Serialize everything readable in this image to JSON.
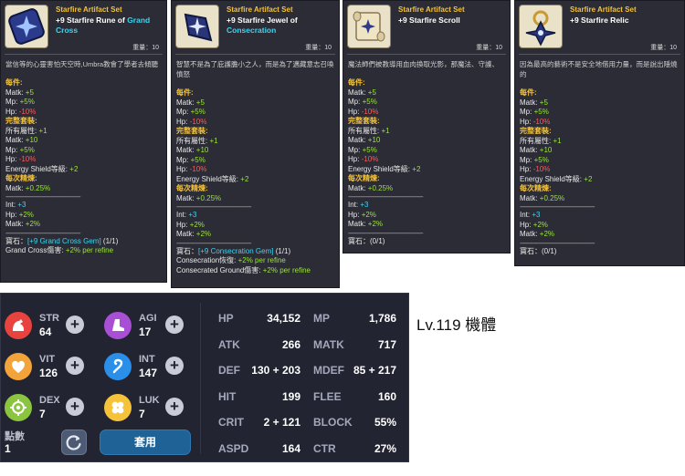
{
  "cards": [
    {
      "set": "Starfire Artifact Set",
      "name_prefix": "+9 Starfire Rune of ",
      "name_highlight": "Grand Cross",
      "weight": "重量：10",
      "description": "當信等的心靈害怕天空時,Umbra教會了學者去傾聽",
      "each_label": "每件:",
      "each": [
        [
          "Matk:",
          "+5",
          "g"
        ],
        [
          "Mp:",
          "+5%",
          "g"
        ],
        [
          "Hp:",
          "-10%",
          "r"
        ]
      ],
      "full_label": "完整套裝:",
      "full": [
        [
          "所有屬性:",
          "+1",
          "g"
        ],
        [
          "Matk:",
          "+10",
          "g"
        ],
        [
          "Mp:",
          "+5%",
          "g"
        ],
        [
          "Hp:",
          "-10%",
          "r"
        ],
        [
          "Energy Shield等級:",
          "+2",
          "g"
        ]
      ],
      "refine_label": "每次精煉:",
      "refine": [
        [
          "Matk:",
          "+0.25%",
          "g"
        ]
      ],
      "dashes": "-------------------------------------------------",
      "bonus": [
        [
          "Int:",
          "+3",
          "b"
        ],
        [
          "Hp:",
          "+2%",
          "g"
        ],
        [
          "Matk:",
          "+2%",
          "g"
        ]
      ],
      "gem_prefix": "寶石：",
      "gem_link": "[+9 Grand Cross Gem]",
      "gem_count": " (1/1)",
      "extras": [
        [
          "Grand Cross傷害:",
          "+2% per refine"
        ]
      ]
    },
    {
      "set": "Starfire Artifact Set",
      "name_prefix": "+9 Starfire Jewel of ",
      "name_highlight": "Consecration",
      "weight": "重量：10",
      "description": "智慧不是為了庇護膽小之人，而是為了邁藏意志召喚憤怒",
      "each_label": "每件:",
      "each": [
        [
          "Matk:",
          "+5",
          "g"
        ],
        [
          "Mp:",
          "+5%",
          "g"
        ],
        [
          "Hp:",
          "-10%",
          "r"
        ]
      ],
      "full_label": "完整套裝:",
      "full": [
        [
          "所有屬性:",
          "+1",
          "g"
        ],
        [
          "Matk:",
          "+10",
          "g"
        ],
        [
          "Mp:",
          "+5%",
          "g"
        ],
        [
          "Hp:",
          "-10%",
          "r"
        ],
        [
          "Energy Shield等級:",
          "+2",
          "g"
        ]
      ],
      "refine_label": "每次精煉:",
      "refine": [
        [
          "Matk:",
          "+0.25%",
          "g"
        ]
      ],
      "dashes": "-------------------------------------------------",
      "bonus": [
        [
          "Int:",
          "+3",
          "b"
        ],
        [
          "Hp:",
          "+2%",
          "g"
        ],
        [
          "Matk:",
          "+2%",
          "g"
        ]
      ],
      "gem_prefix": "寶石：",
      "gem_link": "[+9 Consecration Gem]",
      "gem_count": " (1/1)",
      "extras": [
        [
          "Consecration恢復:",
          "+2% per refine"
        ],
        [
          "Consecrated Ground傷害:",
          "+2% per refine"
        ]
      ]
    },
    {
      "set": "Starfire Artifact Set",
      "name_prefix": "+9 Starfire Scroll",
      "name_highlight": "",
      "weight": "重量：10",
      "description": "魔法師們被教導用血肉換取光影，那魔法、守護、",
      "each_label": "每件:",
      "each": [
        [
          "Matk:",
          "+5",
          "g"
        ],
        [
          "Mp:",
          "+5%",
          "g"
        ],
        [
          "Hp:",
          "-10%",
          "r"
        ]
      ],
      "full_label": "完整套裝:",
      "full": [
        [
          "所有屬性:",
          "+1",
          "g"
        ],
        [
          "Matk:",
          "+10",
          "g"
        ],
        [
          "Mp:",
          "+5%",
          "g"
        ],
        [
          "Hp:",
          "-10%",
          "r"
        ],
        [
          "Energy Shield等級:",
          "+2",
          "g"
        ]
      ],
      "refine_label": "每次精煉:",
      "refine": [
        [
          "Matk:",
          "+0.25%",
          "g"
        ]
      ],
      "dashes": "-------------------------------------------------",
      "bonus": [
        [
          "Int:",
          "+3",
          "b"
        ],
        [
          "Hp:",
          "+2%",
          "g"
        ],
        [
          "Matk:",
          "+2%",
          "g"
        ]
      ],
      "gem_prefix": "寶石：",
      "gem_link": "",
      "gem_count": "(0/1)",
      "extras": []
    },
    {
      "set": "Starfire Artifact Set",
      "name_prefix": "+9 Starfire Relic",
      "name_highlight": "",
      "weight": "重量：10",
      "description": "因為最高的藝術不是安全地借用力量，而是說出隱燒的",
      "each_label": "每件:",
      "each": [
        [
          "Matk:",
          "+5",
          "g"
        ],
        [
          "Mp:",
          "+5%",
          "g"
        ],
        [
          "Hp:",
          "-10%",
          "r"
        ]
      ],
      "full_label": "完整套裝:",
      "full": [
        [
          "所有屬性:",
          "+1",
          "g"
        ],
        [
          "Matk:",
          "+10",
          "g"
        ],
        [
          "Mp:",
          "+5%",
          "g"
        ],
        [
          "Hp:",
          "-10%",
          "r"
        ],
        [
          "Energy Shield等級:",
          "+2",
          "g"
        ]
      ],
      "refine_label": "每次精煉:",
      "refine": [
        [
          "Matk:",
          "+0.25%",
          "g"
        ]
      ],
      "dashes": "-------------------------------------------------",
      "bonus": [
        [
          "Int:",
          "+3",
          "b"
        ],
        [
          "Hp:",
          "+2%",
          "g"
        ],
        [
          "Matk:",
          "+2%",
          "g"
        ]
      ],
      "gem_prefix": "寶石：",
      "gem_link": "",
      "gem_count": "(0/1)",
      "extras": []
    }
  ],
  "primary_stats": [
    {
      "name": "STR",
      "value": "64",
      "icon": "arm-flex-icon",
      "color": "#e8433e"
    },
    {
      "name": "AGI",
      "value": "17",
      "icon": "boot-icon",
      "color": "#a84fd6"
    },
    {
      "name": "VIT",
      "value": "126",
      "icon": "heart-icon",
      "color": "#f2a33a"
    },
    {
      "name": "INT",
      "value": "147",
      "icon": "brain-icon",
      "color": "#2a8fe8"
    },
    {
      "name": "DEX",
      "value": "7",
      "icon": "target-icon",
      "color": "#8bc43e"
    },
    {
      "name": "LUK",
      "value": "7",
      "icon": "clover-icon",
      "color": "#f5c23a"
    }
  ],
  "points": {
    "label": "點數",
    "value": "1"
  },
  "apply_label": "套用",
  "secondary_stats": [
    {
      "name": "HP",
      "value": "34,152"
    },
    {
      "name": "MP",
      "value": "1,786"
    },
    {
      "name": "ATK",
      "value": "266"
    },
    {
      "name": "MATK",
      "value": "717"
    },
    {
      "name": "DEF",
      "value": "130 + 203"
    },
    {
      "name": "MDEF",
      "value": "85 + 217"
    },
    {
      "name": "HIT",
      "value": "199"
    },
    {
      "name": "FLEE",
      "value": "160"
    },
    {
      "name": "CRIT",
      "value": "2 + 121"
    },
    {
      "name": "BLOCK",
      "value": "55%"
    },
    {
      "name": "ASPD",
      "value": "164"
    },
    {
      "name": "CTR",
      "value": "27%"
    }
  ],
  "side_note": "Lv.119 機體",
  "colors": {
    "green": "#9be33d",
    "red": "#ff5a5a",
    "cyan": "#3fd4f0",
    "gold": "#f5c23a",
    "panel": "#222432",
    "card": "#2b2c35"
  }
}
